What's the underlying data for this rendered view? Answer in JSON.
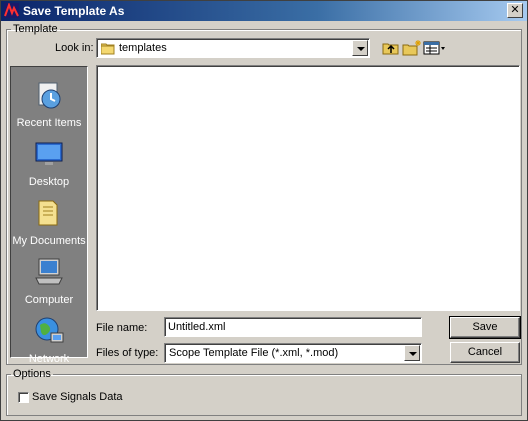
{
  "window": {
    "title": "Save Template As",
    "close_glyph": "✕"
  },
  "template_group": {
    "legend": "Template"
  },
  "lookin": {
    "label": "Look in:",
    "value": "templates"
  },
  "places": [
    {
      "label": "Recent Items",
      "icon": "recent-items-icon"
    },
    {
      "label": "Desktop",
      "icon": "desktop-icon"
    },
    {
      "label": "My Documents",
      "icon": "my-documents-icon"
    },
    {
      "label": "Computer",
      "icon": "computer-icon"
    },
    {
      "label": "Network",
      "icon": "network-icon"
    }
  ],
  "filename": {
    "label": "File name:",
    "value": "Untitled.xml"
  },
  "filetype": {
    "label": "Files of type:",
    "value": "Scope Template File (*.xml, *.mod)"
  },
  "buttons": {
    "save": "Save",
    "cancel": "Cancel"
  },
  "options_group": {
    "legend": "Options",
    "save_signals_label": "Save Signals Data",
    "save_signals_checked": false
  },
  "colors": {
    "titlebar_start": "#0a246a",
    "titlebar_end": "#a6caf0",
    "dialog_bg": "#d4d0c8",
    "places_bg": "#808080"
  }
}
